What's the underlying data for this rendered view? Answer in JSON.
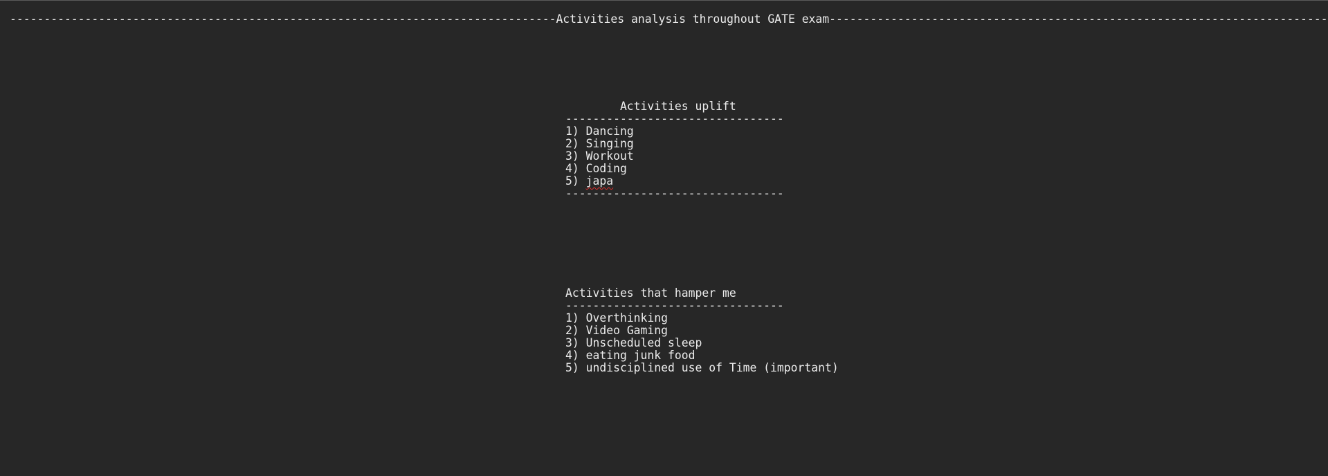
{
  "document": {
    "title_line": "--------------------------------------------------------------------------------Activities analysis throughout GATE exam-------------------------------------------------------------------------------",
    "uplift": {
      "heading": "        Activities uplift",
      "rule_top": "--------------------------------",
      "items": [
        {
          "prefix": "1) ",
          "text": "Dancing"
        },
        {
          "prefix": "2) ",
          "text": "Singing"
        },
        {
          "prefix": "3) ",
          "text": "Workout"
        },
        {
          "prefix": "4) ",
          "text": "Coding"
        },
        {
          "prefix": "5) ",
          "text": "japa"
        }
      ],
      "rule_bottom": "--------------------------------"
    },
    "hamper": {
      "heading": "Activities that hamper me",
      "rule_top": "--------------------------------",
      "items": [
        {
          "prefix": "1) ",
          "text": "Overthinking"
        },
        {
          "prefix": "2) ",
          "text": "Video Gaming"
        },
        {
          "prefix": "3) ",
          "text": "Unscheduled sleep"
        },
        {
          "prefix": "4) ",
          "text": "eating junk food"
        },
        {
          "prefix": "5) ",
          "text": "undisciplined use of Time (important)"
        }
      ]
    }
  },
  "colors": {
    "background": "#272727",
    "text": "#ececec",
    "spellcheck_underline": "#e0302e"
  }
}
